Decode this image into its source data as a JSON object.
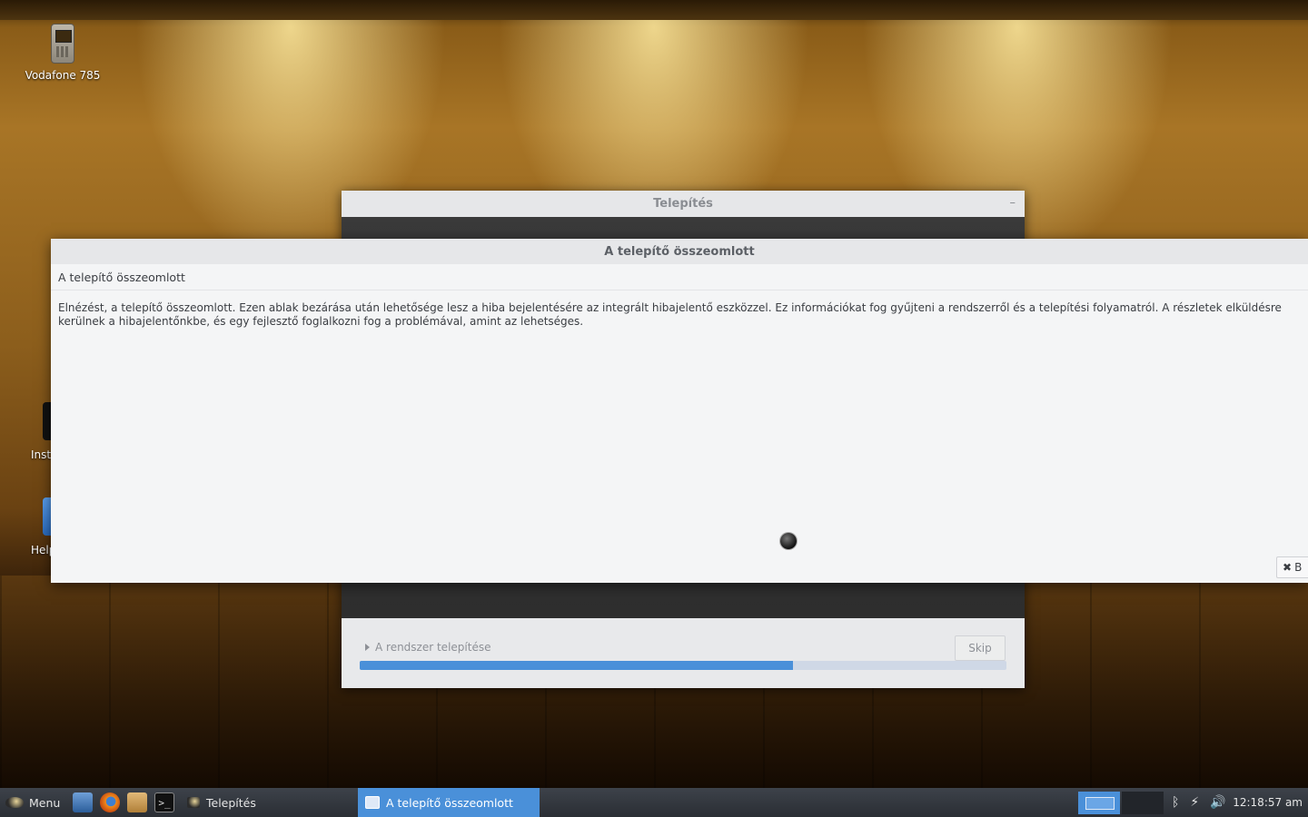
{
  "desktop": {
    "icons": [
      {
        "label": "Vodafone 785",
        "icon": "phone-icon"
      },
      {
        "label": "Inst",
        "icon": "installer-icon"
      },
      {
        "label": "Help",
        "icon": "help-icon"
      }
    ]
  },
  "installer_window": {
    "title": "Telepítés",
    "minimize_label": "–",
    "step_label": "A rendszer telepítése",
    "skip_label": "Skip",
    "progress": 0.67,
    "progress_color": "#4a90d9"
  },
  "crash_dialog": {
    "title": "A telepítő összeomlott",
    "heading": "A telepítő összeomlott",
    "message": "Elnézést, a telepítő összeomlott. Ezen ablak bezárása után lehetősége lesz a hiba bejelentésére az integrált hibajelentő eszközzel. Ez információkat fog gyűjteni a rendszerről és a telepítési folyamatról. A részletek elküldésre kerülnek a hibajelentőnkbe, és egy fejlesztő foglalkozni fog a problémával, amint az lehetséges.",
    "close_label": "B",
    "close_icon": "close-x-icon"
  },
  "taskbar": {
    "menu_label": "Menu",
    "launchers": [
      "show-desktop-icon",
      "firefox-icon",
      "home-folder-icon",
      "terminal-icon"
    ],
    "tasks": [
      {
        "label": "Telepítés",
        "active": false
      },
      {
        "label": "A telepítő összeomlott",
        "active": true
      }
    ],
    "tray_icons": [
      "bluetooth-icon",
      "network-icon",
      "volume-icon"
    ],
    "clock": "12:18:57 am",
    "accent": "#4a90d9"
  }
}
